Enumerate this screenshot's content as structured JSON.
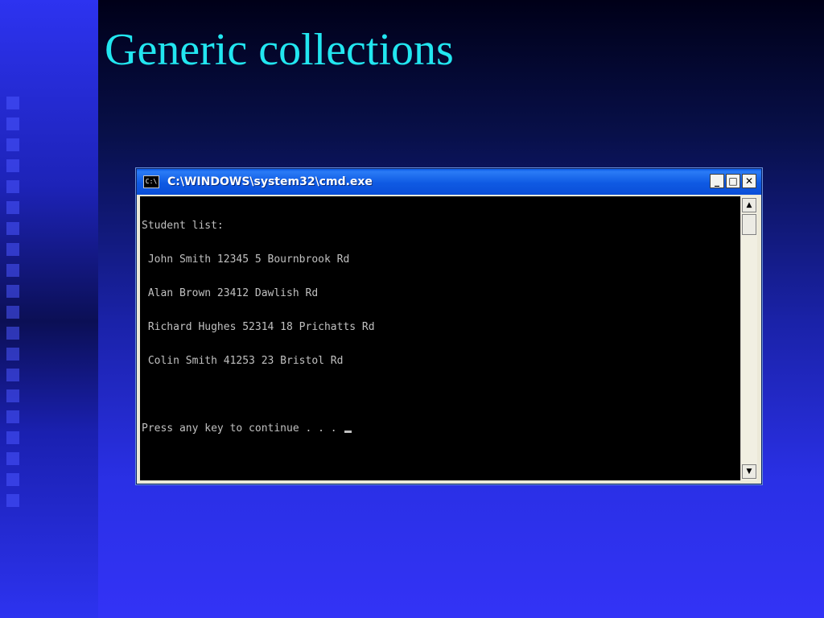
{
  "slide": {
    "title": "Generic collections"
  },
  "window": {
    "title": "C:\\WINDOWS\\system32\\cmd.exe",
    "icon_label": "C:\\",
    "minimize_label": "_",
    "maximize_label": "□",
    "close_label": "✕"
  },
  "console": {
    "lines": [
      "Student list:",
      " John Smith 12345 5 Bournbrook Rd",
      " Alan Brown 23412 Dawlish Rd",
      " Richard Hughes 52314 18 Prichatts Rd",
      " Colin Smith 41253 23 Bristol Rd",
      "",
      "Press any key to continue . . . "
    ]
  },
  "scrollbar": {
    "up_label": "▲",
    "down_label": "▼"
  },
  "colors": {
    "title": "#22e6f0",
    "console_bg": "#000000",
    "console_text": "#c0c0c0",
    "titlebar": "#0a5ae8"
  }
}
